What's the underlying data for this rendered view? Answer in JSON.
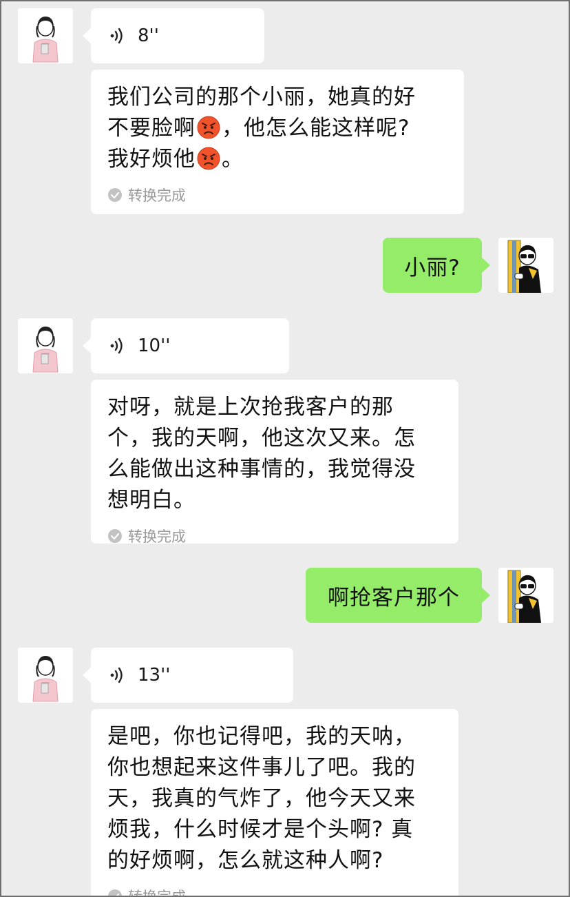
{
  "messages": [
    {
      "side": "left",
      "type": "voice",
      "duration": "8''",
      "icon": "voice-wave-icon"
    },
    {
      "side": "left",
      "type": "transcript",
      "lines": [
        "我们公司的那个小丽，她真的好",
        "不要脸啊",
        "，他怎么能这样呢?",
        "我好烦他",
        "。"
      ],
      "status": "转换完成"
    },
    {
      "side": "right",
      "type": "text",
      "text": "小丽?"
    },
    {
      "side": "left",
      "type": "voice",
      "duration": "10''",
      "icon": "voice-wave-icon"
    },
    {
      "side": "left",
      "type": "transcript",
      "lines": [
        "对呀，就是上次抢我客户的那",
        "个，我的天啊，他这次又来。怎",
        "么能做出这种事情的，我觉得没",
        "想明白。"
      ],
      "status": "转换完成"
    },
    {
      "side": "right",
      "type": "text",
      "text": "啊抢客户那个"
    },
    {
      "side": "left",
      "type": "voice",
      "duration": "13''",
      "icon": "voice-wave-icon"
    },
    {
      "side": "left",
      "type": "transcript",
      "lines": [
        "是吧，你也记得吧，我的天呐，",
        "你也想起来这件事儿了吧。我的",
        "天，我真的气炸了，他今天又来",
        "烦我，什么时候才是个头啊? 真",
        "的好烦啊，怎么就这种人啊?"
      ],
      "status": "转换完成"
    }
  ],
  "colors": {
    "background": "#ececec",
    "received_bubble": "#ffffff",
    "sent_bubble": "#95ec69",
    "status_text": "#9a9a9a"
  },
  "icons": {
    "emoji": "angry-face-emoji",
    "status": "check-circle-icon",
    "voice": "voice-wave-icon",
    "avatar_left": "girl-cartoon-avatar",
    "avatar_right": "sunglasses-man-avatar"
  }
}
